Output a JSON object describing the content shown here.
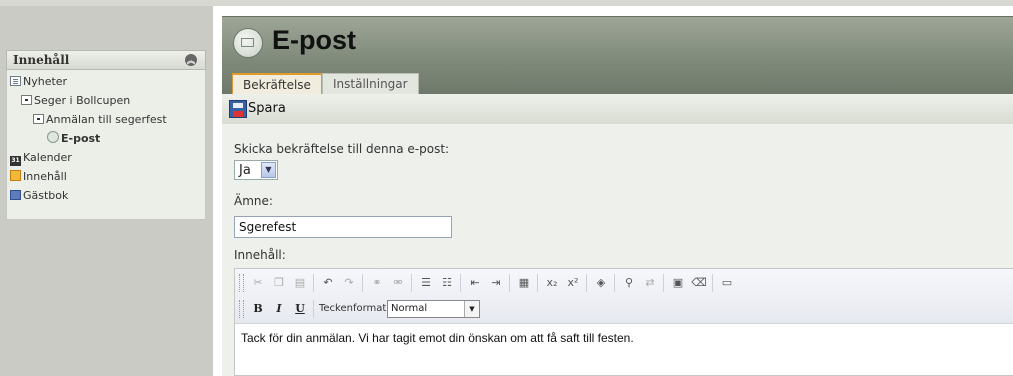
{
  "sidebar": {
    "header_title": "Innehåll",
    "items": [
      {
        "label": "Nyheter",
        "icon": "document-list-icon"
      },
      {
        "label": "Seger i Bollcupen",
        "icon": "page-icon"
      },
      {
        "label": "Anmälan till segerfest",
        "icon": "form-page-icon"
      },
      {
        "label": "E-post",
        "icon": "envelope-icon"
      },
      {
        "label": "Kalender",
        "icon": "calendar-icon",
        "icon_text": "31"
      },
      {
        "label": "Innehåll",
        "icon": "content-box-icon"
      },
      {
        "label": "Gästbok",
        "icon": "guestbook-icon"
      }
    ]
  },
  "header": {
    "title": "E-post"
  },
  "tabs": [
    {
      "label": "Bekräftelse",
      "active": true
    },
    {
      "label": "Inställningar",
      "active": false
    }
  ],
  "toolbar": {
    "save_label": "Spara"
  },
  "form": {
    "confirm_label": "Skicka bekräftelse till denna e-post:",
    "confirm_value": "Ja",
    "subject_label": "Ämne:",
    "subject_value": "Sgerefest",
    "content_label": "Innehåll:",
    "format_label": "Teckenformat",
    "format_value": "Normal",
    "body_text": "Tack för din anmälan. Vi har tagit emot din önskan om att få saft till festen."
  },
  "editor_toolbar": {
    "bold": "B",
    "italic": "I",
    "underline": "U"
  },
  "colors": {
    "sidebar_bg": "#c9cbc4",
    "titlebar": "#8d9687",
    "tab_active_accent": "#e39b2a",
    "form_bg": "#eef0ec"
  }
}
